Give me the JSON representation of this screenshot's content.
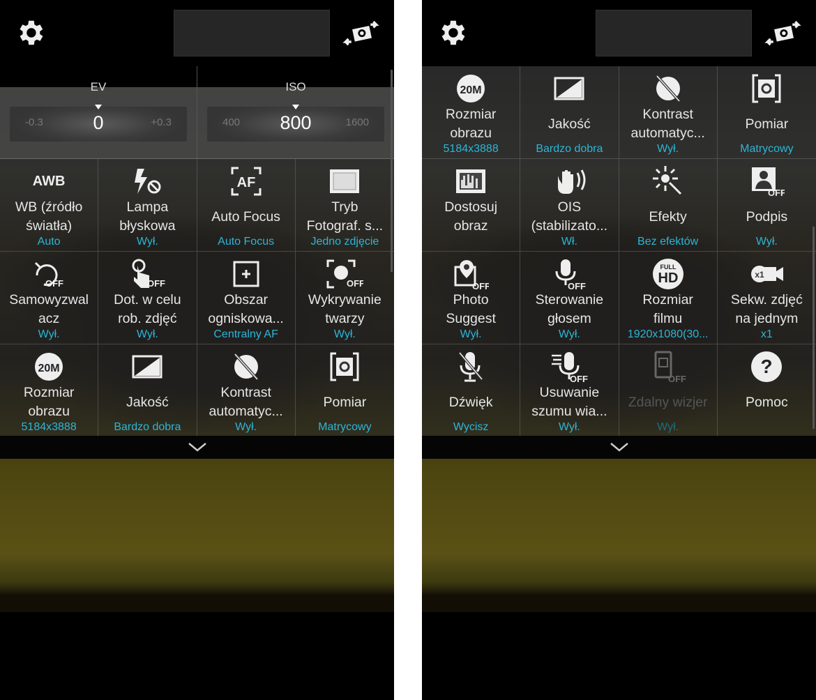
{
  "colors": {
    "accent": "#2bb6d8",
    "label": "#e6e6e6",
    "background": "#000000"
  },
  "screens": [
    {
      "topbar": {
        "settings_icon": "gear-icon",
        "switch_icon": "switch-camera-icon"
      },
      "exposure": {
        "ev": {
          "title": "EV",
          "low": "-0.3",
          "value": "0",
          "high": "+0.3"
        },
        "iso": {
          "title": "ISO",
          "low": "400",
          "value": "800",
          "high": "1600"
        }
      },
      "settings": [
        {
          "icon": "awb-icon",
          "icon_text": "AWB",
          "label": "WB (źródło\nświatła)",
          "value": "Auto"
        },
        {
          "icon": "flash-off-icon",
          "label": "Lampa\nbłyskowa",
          "value": "Wył."
        },
        {
          "icon": "autofocus-icon",
          "icon_text": "AF",
          "label": "Auto Focus",
          "value": "Auto Focus"
        },
        {
          "icon": "single-shot-icon",
          "label": "Tryb\nFotograf. s...",
          "value": "Jedno zdjęcie"
        },
        {
          "icon": "timer-off-icon",
          "label": "Samowyzwal\nacz",
          "value": "Wył."
        },
        {
          "icon": "tap-shoot-off-icon",
          "label": "Dot. w celu\nrob. zdjęć",
          "value": "Wył."
        },
        {
          "icon": "focus-area-icon",
          "label": "Obszar\nogniskowa...",
          "value": "Centralny AF"
        },
        {
          "icon": "face-detect-off-icon",
          "label": "Wykrywanie\ntwarzy",
          "value": "Wył."
        },
        {
          "icon": "size-20m-icon",
          "icon_text": "20M",
          "label": "Rozmiar\nobrazu",
          "value": "5184x3888"
        },
        {
          "icon": "quality-icon",
          "label": "Jakość",
          "value": "Bardzo dobra"
        },
        {
          "icon": "auto-contrast-off-icon",
          "label": "Kontrast\nautomatyc...",
          "value": "Wył."
        },
        {
          "icon": "metering-icon",
          "label": "Pomiar",
          "value": "Matrycowy"
        }
      ]
    },
    {
      "topbar": {
        "settings_icon": "gear-icon",
        "switch_icon": "switch-camera-icon"
      },
      "settings": [
        {
          "icon": "size-20m-icon",
          "icon_text": "20M",
          "label": "Rozmiar\nobrazu",
          "value": "5184x3888"
        },
        {
          "icon": "quality-icon",
          "label": "Jakość",
          "value": "Bardzo dobra"
        },
        {
          "icon": "auto-contrast-off-icon",
          "label": "Kontrast\nautomatyc...",
          "value": "Wył."
        },
        {
          "icon": "metering-icon",
          "label": "Pomiar",
          "value": "Matrycowy"
        },
        {
          "icon": "adjust-image-icon",
          "label": "Dostosuj\nobraz",
          "value": ""
        },
        {
          "icon": "ois-icon",
          "label": "OIS\n(stabilizato...",
          "value": "Wł."
        },
        {
          "icon": "effects-icon",
          "label": "Efekty",
          "value": "Bez efektów"
        },
        {
          "icon": "signature-off-icon",
          "label": "Podpis",
          "value": "Wył."
        },
        {
          "icon": "photo-suggest-off-icon",
          "label": "Photo\nSuggest",
          "value": "Wył."
        },
        {
          "icon": "voice-control-off-icon",
          "label": "Sterowanie\ngłosem",
          "value": "Wył."
        },
        {
          "icon": "full-hd-icon",
          "icon_text": "HD",
          "label": "Rozmiar\nfilmu",
          "value": "1920x1080(30..."
        },
        {
          "icon": "burst-shot-icon",
          "label": "Sekw. zdjęć\nna jednym",
          "value": "x1"
        },
        {
          "icon": "mute-mic-icon",
          "label": "Dźwięk",
          "value": "Wycisz"
        },
        {
          "icon": "wind-noise-off-icon",
          "label": "Usuwanie\nszumu wia...",
          "value": "Wył."
        },
        {
          "icon": "remote-viewfinder-off-icon",
          "label": "Zdalny wizjer",
          "value": "Wył.",
          "disabled": true
        },
        {
          "icon": "help-icon",
          "icon_text": "?",
          "label": "Pomoc",
          "value": ""
        }
      ]
    }
  ]
}
